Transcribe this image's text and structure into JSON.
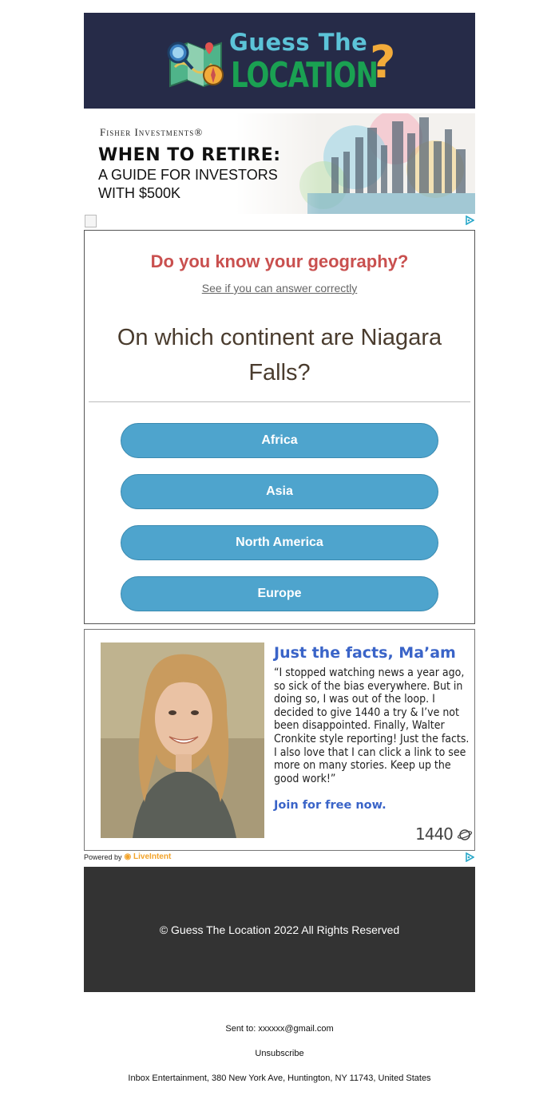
{
  "header": {
    "logo_line1": "Guess The",
    "logo_line2": "LOCATION",
    "logo_mark": "?"
  },
  "ad_banner": {
    "brand": "Fisher Investments®",
    "headline": "WHEN TO RETIRE:",
    "subline1": "A GUIDE FOR INVESTORS",
    "subline2": "WITH $500K"
  },
  "quiz": {
    "title": "Do you know your geography?",
    "subtitle": "See if you can answer correctly",
    "question": "On which continent are Niagara Falls?",
    "answers": [
      "Africa",
      "Asia",
      "North America",
      "Europe"
    ]
  },
  "promo": {
    "title": "Just the facts, Ma’am",
    "body": "“I stopped watching news a year ago, so sick of the bias everywhere. But in doing so, I was out of the loop. I decided to give 1440 a try & I’ve not been disappointed. Finally, Walter Cronkite style reporting! Just the facts. I also love that I can click a link to see more on many stories. Keep up the good work!”",
    "cta": "Join for free now.",
    "brand": "1440"
  },
  "powered_by": {
    "label": "Powered by",
    "brand": "LiveIntent"
  },
  "footer": {
    "copyright": "© Guess The Location 2022 All Rights Reserved",
    "sent_to": "Sent to: xxxxxx@gmail.com",
    "unsubscribe": "Unsubscribe",
    "address": "Inbox Entertainment, 380 New York Ave, Huntington, NY 11743, United States"
  },
  "colors": {
    "header_bg": "#262b48",
    "quiz_title": "#c9504f",
    "answer_button": "#4ea4cd",
    "promo_accent": "#3a64c8",
    "footer_bg": "#333333"
  },
  "icons": {
    "ad_choices": "adchoices-icon",
    "logo": "map-compass-icon"
  }
}
